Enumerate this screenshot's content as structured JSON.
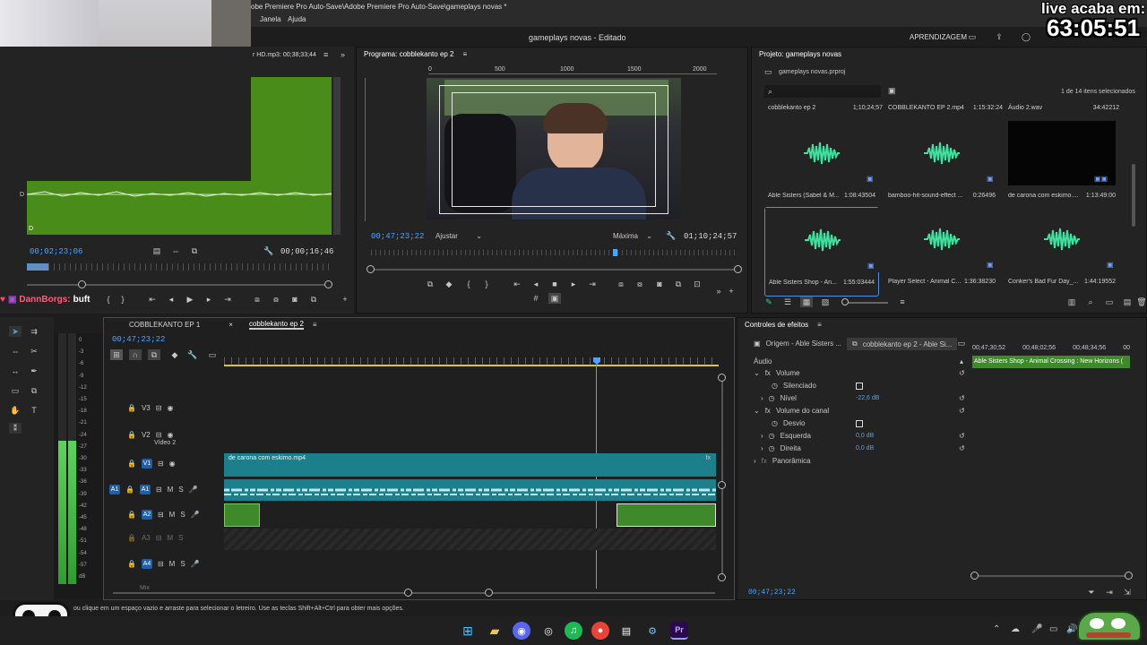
{
  "app": {
    "title": "gameplays novas - Editado",
    "path_title": "obe Premiere Pro Auto-Save\\Adobe Premiere Pro Auto-Save\\gameplays novas *",
    "menu": [
      "Janela",
      "Ajuda"
    ],
    "workspace": "APRENDIZAGEM"
  },
  "overlay": {
    "timer_label": "live acaba em:",
    "timer_value": "63:05:51",
    "chat_user": "DannBorgs:",
    "chat_msg": "buft"
  },
  "source": {
    "tab": "r HD.mp3: 00;38;33;44",
    "timecode_in": "00;02;23;06",
    "timecode_dur": "00;00;16;46"
  },
  "program": {
    "tab": "Programa: cobblekanto ep 2",
    "timecode": "00;47;23;22",
    "fit": "Ajustar",
    "quality": "Máxima",
    "duration": "01;10;24;57",
    "ruler": [
      "0",
      "500",
      "1000",
      "1500",
      "2000"
    ]
  },
  "project": {
    "tab": "Projeto: gameplays novas",
    "file": "gameplays novas.prproj",
    "selection": "1 de 14 itens selecionados",
    "top_row": [
      {
        "name": "cobblekanto ep 2",
        "dur": "1;10;24;57"
      },
      {
        "name": "COBBLEKANTO EP 2.mp4",
        "dur": "1:15:32:24"
      },
      {
        "name": "Áudio 2.wav",
        "dur": "34:42212"
      }
    ],
    "items": [
      {
        "name": "Able Sisters (Sabel & M...",
        "dur": "1:08:43504"
      },
      {
        "name": "bamboo-hit-sound-effect ...",
        "dur": "0:26496"
      },
      {
        "name": "de carona com eskimo....",
        "dur": "1:13:49:00"
      },
      {
        "name": "Able Sisters Shop - An...",
        "dur": "1:55:03444"
      },
      {
        "name": "Player Select - Animal C...",
        "dur": "1:36:38230"
      },
      {
        "name": "Conker's Bad Fur Day_...",
        "dur": "1:44:19552"
      }
    ]
  },
  "timeline": {
    "tabs": [
      "COBBLEKANTO EP 1",
      "cobblekanto ep 2"
    ],
    "timecode": "00;47;23;22",
    "tracks_video": [
      "V3",
      "V2",
      "V1"
    ],
    "v2_name": "Vídeo 2",
    "tracks_audio": [
      "A1",
      "A2",
      "A3",
      "A4"
    ],
    "mix": "Mix",
    "clip_video": "de carona com eskimo.mp4",
    "meter_scale": [
      "0",
      "-3",
      "-6",
      "-9",
      "-12",
      "-15",
      "-18",
      "-21",
      "-24",
      "-27",
      "-30",
      "-33",
      "-36",
      "-39",
      "-42",
      "-45",
      "-48",
      "-51",
      "-54",
      "-57",
      "dB"
    ]
  },
  "effects": {
    "title": "Controles de efeitos",
    "tab_source": "Origem - Able Sisters ...",
    "tab_seq": "cobblekanto ep 2 - Able Si...",
    "ruler": [
      "00;47;30;52",
      "00;48;02;56",
      "00;48;34;56",
      "00"
    ],
    "clip_name": "Able Sisters Shop - Animal Crossing : New Horizons (",
    "section": "Áudio",
    "volume": "Volume",
    "mute": "Silenciado",
    "level": "Nível",
    "level_val": "-22,6 dB",
    "channel_volume": "Volume do canal",
    "bypass": "Desvio",
    "left": "Esquerda",
    "left_val": "0,0 dB",
    "right": "Direita",
    "right_val": "0,0 dB",
    "panner": "Panorâmica",
    "timecode": "00;47;23;22"
  },
  "status": {
    "hint": "ou clique em um espaço vazio e arraste para selecionar o letreiro. Use as teclas Shift+Alt+Ctrl para obter mais opções."
  },
  "colors": {
    "accent": "#2d8ceb",
    "audio_clip": "#3e8a2a",
    "video_clip": "#1b7f8c",
    "source_green": "#4a8c1a"
  }
}
